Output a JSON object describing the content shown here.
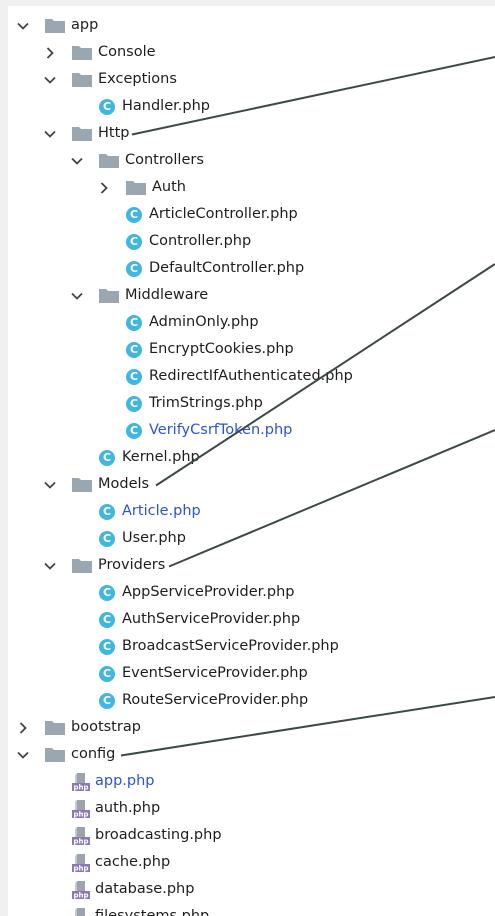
{
  "tree": {
    "rows": [
      {
        "label": "app",
        "kind": "folder",
        "level": 0,
        "expanded": true,
        "icon": "folder-icon"
      },
      {
        "label": "Console",
        "kind": "folder",
        "level": 1,
        "expanded": false,
        "icon": "folder-icon"
      },
      {
        "label": "Exceptions",
        "kind": "folder",
        "level": 1,
        "expanded": true,
        "icon": "folder-icon"
      },
      {
        "label": "Handler.php",
        "kind": "class",
        "level": 2,
        "icon": "class-icon"
      },
      {
        "label": "Http",
        "kind": "folder",
        "level": 1,
        "expanded": true,
        "icon": "folder-icon"
      },
      {
        "label": "Controllers",
        "kind": "folder",
        "level": 2,
        "expanded": true,
        "icon": "folder-icon"
      },
      {
        "label": "Auth",
        "kind": "folder",
        "level": 3,
        "expanded": false,
        "icon": "folder-icon"
      },
      {
        "label": "ArticleController.php",
        "kind": "class",
        "level": 3,
        "icon": "class-icon"
      },
      {
        "label": "Controller.php",
        "kind": "class",
        "level": 3,
        "icon": "class-icon"
      },
      {
        "label": "DefaultController.php",
        "kind": "class",
        "level": 3,
        "icon": "class-icon"
      },
      {
        "label": "Middleware",
        "kind": "folder",
        "level": 2,
        "expanded": true,
        "icon": "folder-icon"
      },
      {
        "label": "AdminOnly.php",
        "kind": "class",
        "level": 3,
        "icon": "class-icon"
      },
      {
        "label": "EncryptCookies.php",
        "kind": "class",
        "level": 3,
        "icon": "class-icon"
      },
      {
        "label": "RedirectIfAuthenticated.php",
        "kind": "class",
        "level": 3,
        "icon": "class-icon"
      },
      {
        "label": "TrimStrings.php",
        "kind": "class",
        "level": 3,
        "icon": "class-icon"
      },
      {
        "label": "VerifyCsrfToken.php",
        "kind": "class",
        "level": 3,
        "icon": "class-icon",
        "modified": true
      },
      {
        "label": "Kernel.php",
        "kind": "class",
        "level": 2,
        "icon": "class-icon"
      },
      {
        "label": "Models",
        "kind": "folder",
        "level": 1,
        "expanded": true,
        "icon": "folder-icon"
      },
      {
        "label": "Article.php",
        "kind": "class",
        "level": 2,
        "icon": "class-icon",
        "modified": true
      },
      {
        "label": "User.php",
        "kind": "class",
        "level": 2,
        "icon": "class-icon"
      },
      {
        "label": "Providers",
        "kind": "folder",
        "level": 1,
        "expanded": true,
        "icon": "folder-icon"
      },
      {
        "label": "AppServiceProvider.php",
        "kind": "class",
        "level": 2,
        "icon": "class-icon"
      },
      {
        "label": "AuthServiceProvider.php",
        "kind": "class",
        "level": 2,
        "icon": "class-icon"
      },
      {
        "label": "BroadcastServiceProvider.php",
        "kind": "class",
        "level": 2,
        "icon": "class-icon"
      },
      {
        "label": "EventServiceProvider.php",
        "kind": "class",
        "level": 2,
        "icon": "class-icon"
      },
      {
        "label": "RouteServiceProvider.php",
        "kind": "class",
        "level": 2,
        "icon": "class-icon"
      },
      {
        "label": "bootstrap",
        "kind": "folder",
        "level": 0,
        "expanded": false,
        "icon": "folder-icon"
      },
      {
        "label": "config",
        "kind": "folder",
        "level": 0,
        "expanded": true,
        "icon": "folder-icon"
      },
      {
        "label": "app.php",
        "kind": "php",
        "level": 1,
        "icon": "php-file-icon",
        "modified": true
      },
      {
        "label": "auth.php",
        "kind": "php",
        "level": 1,
        "icon": "php-file-icon"
      },
      {
        "label": "broadcasting.php",
        "kind": "php",
        "level": 1,
        "icon": "php-file-icon"
      },
      {
        "label": "cache.php",
        "kind": "php",
        "level": 1,
        "icon": "php-file-icon"
      },
      {
        "label": "database.php",
        "kind": "php",
        "level": 1,
        "icon": "php-file-icon"
      },
      {
        "label": "filesystems.php",
        "kind": "php",
        "level": 1,
        "icon": "php-file-icon"
      }
    ]
  },
  "icons": {
    "class_letter": "C",
    "php_badge": "php"
  },
  "colors": {
    "modified_text": "#2a54d6",
    "class_icon": "#40b6e0",
    "folder": "#9aa7b0",
    "annotation_line": "#3c4a42"
  },
  "annotations": [
    {
      "from_row": "Http",
      "to": "off-panel-upper-right"
    },
    {
      "from_row": "Models",
      "to": "off-panel-right"
    },
    {
      "from_row": "Providers",
      "to": "off-panel-right"
    },
    {
      "from_row": "config",
      "to": "off-panel-right"
    }
  ]
}
